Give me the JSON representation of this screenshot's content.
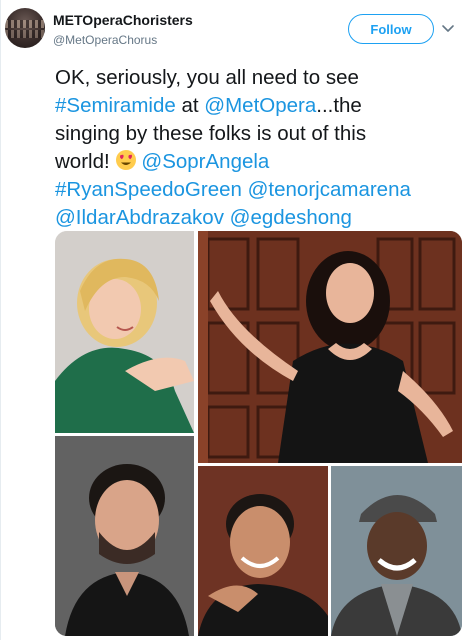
{
  "tweet": {
    "display_name": "METOperaChoristers",
    "handle": "@MetOperaChorus",
    "follow_label": "Follow",
    "text_lines": [
      [
        {
          "t": "OK, seriously, you all need to see",
          "link": false
        }
      ],
      [
        {
          "t": "#Semiramide",
          "link": true
        },
        {
          "t": " at ",
          "link": false
        },
        {
          "t": "@MetOpera",
          "link": true
        },
        {
          "t": "...the",
          "link": false
        }
      ],
      [
        {
          "t": "singing by these folks is out of this",
          "link": false
        }
      ],
      [
        {
          "t": "world! ",
          "link": false
        },
        {
          "emoji": "heart-eyes-emoji"
        },
        {
          "t": "@SoprAngela",
          "link": true
        }
      ],
      [
        {
          "t": "#RyanSpeedoGreen",
          "link": true
        },
        {
          "t": " ",
          "link": false
        },
        {
          "t": "@tenorjcamarena",
          "link": true
        }
      ],
      [
        {
          "t": "@IldarAbdrazakov",
          "link": true
        },
        {
          "t": " ",
          "link": false
        },
        {
          "t": "@egdeshong",
          "link": true
        }
      ]
    ],
    "media": [
      {
        "name": "photo-blonde-woman-green-dress"
      },
      {
        "name": "photo-woman-black-dress-wood-door"
      },
      {
        "name": "photo-man-dark-shirt"
      },
      {
        "name": "photo-man-smiling-leaning"
      },
      {
        "name": "photo-man-gray-cap-vest"
      }
    ],
    "colors": {
      "link": "#1b95e0",
      "follow": "#1da1f2",
      "text": "#14171a",
      "muted": "#657786"
    }
  }
}
